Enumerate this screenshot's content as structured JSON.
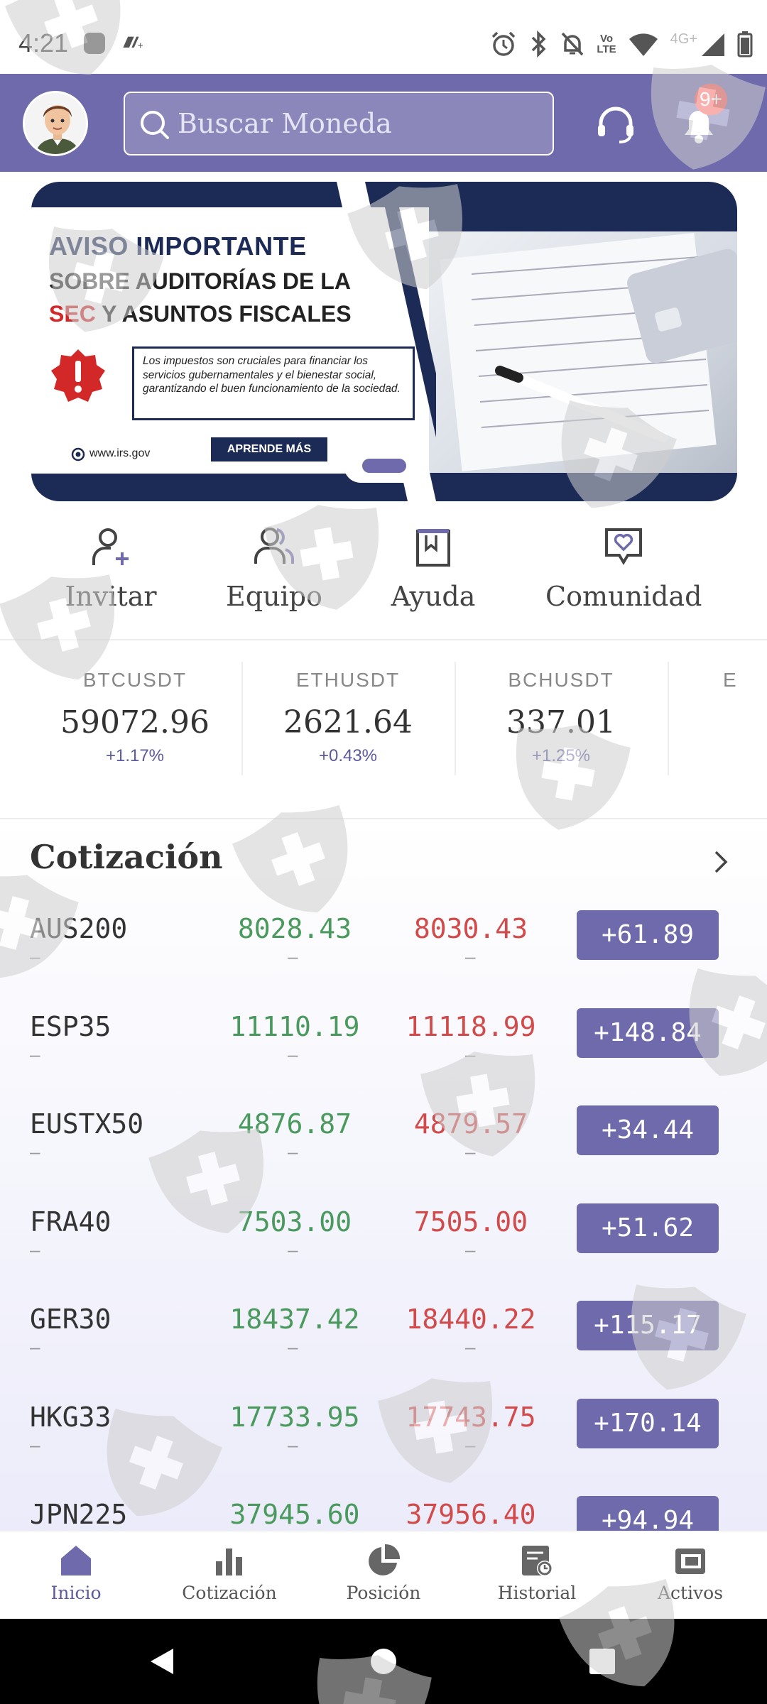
{
  "status_bar": {
    "time": "4:21",
    "volte": "Vo\nLTE",
    "network": "4G+"
  },
  "header": {
    "search_placeholder": "Buscar Moneda",
    "notification_badge": "9+"
  },
  "banner": {
    "title": "AVISO IMPORTANTE",
    "line2": "SOBRE AUDITORÍAS DE LA",
    "line3_highlight": "SEC",
    "line3_rest": " Y ASUNTOS FISCALES",
    "body": "Los impuestos son cruciales para financiar los servicios gubernamentales y el bienestar social, garantizando el buen funcionamiento de la sociedad.",
    "cta": "APRENDE MÁS",
    "url": "www.irs.gov"
  },
  "quick_actions": [
    {
      "label": "Invitar",
      "icon": "invite-user-icon"
    },
    {
      "label": "Equipo",
      "icon": "team-icon"
    },
    {
      "label": "Ayuda",
      "icon": "help-book-icon"
    },
    {
      "label": "Comunidad",
      "icon": "community-chat-icon"
    }
  ],
  "tickers": [
    {
      "symbol": "BTCUSDT",
      "price": "59072.96",
      "change": "+1.17%"
    },
    {
      "symbol": "ETHUSDT",
      "price": "2621.64",
      "change": "+0.43%"
    },
    {
      "symbol": "BCHUSDT",
      "price": "337.01",
      "change": "+1.25%"
    },
    {
      "symbol": "E",
      "price": "",
      "change": ""
    }
  ],
  "quotes": {
    "title": "Cotización",
    "rows": [
      {
        "symbol": "AUS200",
        "bid": "8028.43",
        "ask": "8030.43",
        "change": "+61.89",
        "sub": "–"
      },
      {
        "symbol": "ESP35",
        "bid": "11110.19",
        "ask": "11118.99",
        "change": "+148.84",
        "sub": "–"
      },
      {
        "symbol": "EUSTX50",
        "bid": "4876.87",
        "ask": "4879.57",
        "change": "+34.44",
        "sub": "–"
      },
      {
        "symbol": "FRA40",
        "bid": "7503.00",
        "ask": "7505.00",
        "change": "+51.62",
        "sub": "–"
      },
      {
        "symbol": "GER30",
        "bid": "18437.42",
        "ask": "18440.22",
        "change": "+115.17",
        "sub": "–"
      },
      {
        "symbol": "HKG33",
        "bid": "17733.95",
        "ask": "17743.75",
        "change": "+170.14",
        "sub": "–"
      },
      {
        "symbol": "JPN225",
        "bid": "37945.60",
        "ask": "37956.40",
        "change": "+94.94",
        "sub": "–"
      }
    ]
  },
  "bottom_nav": [
    {
      "label": "Inicio",
      "icon": "home-icon",
      "active": true
    },
    {
      "label": "Cotización",
      "icon": "bar-chart-icon",
      "active": false
    },
    {
      "label": "Posición",
      "icon": "pie-chart-icon",
      "active": false
    },
    {
      "label": "Historial",
      "icon": "history-icon",
      "active": false
    },
    {
      "label": "Activos",
      "icon": "wallet-icon",
      "active": false
    }
  ],
  "colors": {
    "brand": "#6e6aab",
    "bid": "#4a9a5d",
    "ask": "#d24a4a",
    "badge": "#f2534d"
  }
}
